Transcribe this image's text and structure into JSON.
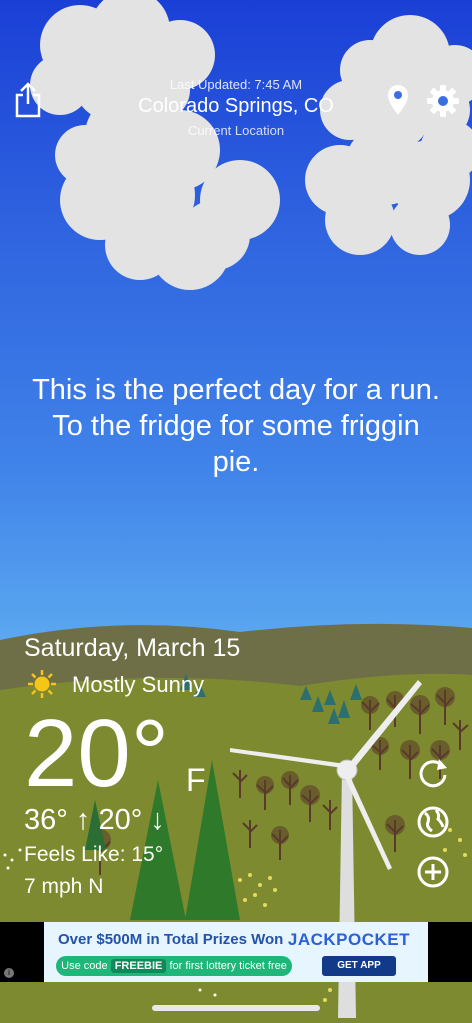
{
  "header": {
    "last_updated": "Last Updated: 7:45 AM",
    "city": "Colorado Springs, CO",
    "location_label": "Current Location"
  },
  "message": "This is the perfect day for a run. To the fridge for some friggin pie.",
  "weather": {
    "date": "Saturday, March 15",
    "condition": "Mostly Sunny",
    "condition_icon": "sun-icon",
    "temperature": "20°",
    "unit": "F",
    "high": "36°",
    "low": "20°",
    "feels_like": "Feels Like: 15°",
    "wind": "7 mph N"
  },
  "icons": {
    "share": "share-icon",
    "location": "location-pin-icon",
    "settings": "gear-icon",
    "refresh": "refresh-icon",
    "globe": "globe-icon",
    "add": "add-icon"
  },
  "ad": {
    "headline": "Over $500M in Total Prizes Won",
    "brand": "JACKPOCKET",
    "code_prefix": "Use code",
    "code": "FREEBIE",
    "code_suffix": "for first lottery ticket free",
    "cta": "GET APP",
    "info": "i"
  },
  "colors": {
    "sky_top": "#1a3fd6",
    "sky_bottom": "#6ab6f1",
    "hill_far": "#6e6e47",
    "hill_near": "#7e8a2f",
    "ad_background": "#e6f5ff"
  }
}
